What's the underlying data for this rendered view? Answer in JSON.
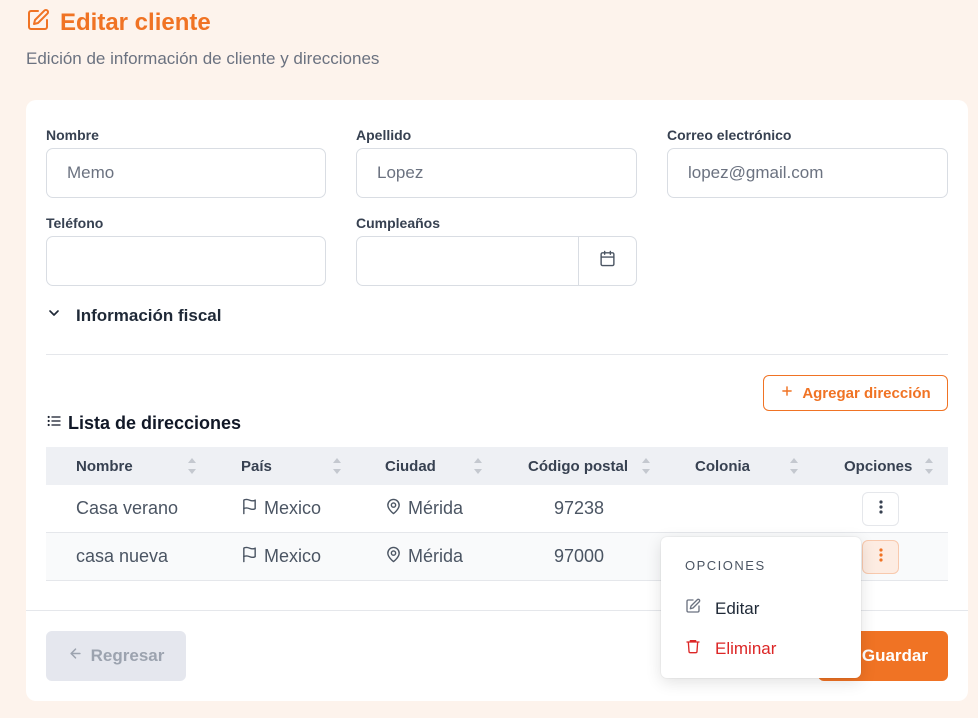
{
  "header": {
    "title": "Editar cliente",
    "subtitle": "Edición de información de cliente y direcciones"
  },
  "form": {
    "nombre_label": "Nombre",
    "nombre_value": "Memo",
    "apellido_label": "Apellido",
    "apellido_value": "Lopez",
    "correo_label": "Correo electrónico",
    "correo_value": "lopez@gmail.com",
    "telefono_label": "Teléfono",
    "telefono_value": "",
    "cumple_label": "Cumpleaños",
    "cumple_value": ""
  },
  "fiscal": {
    "label": "Información fiscal"
  },
  "addresses": {
    "add_label": "Agregar dirección",
    "list_title": "Lista de direcciones",
    "columns": [
      "Nombre",
      "País",
      "Ciudad",
      "Código postal",
      "Colonia",
      "Opciones"
    ],
    "rows": [
      {
        "nombre": "Casa verano",
        "pais": "Mexico",
        "ciudad": "Mérida",
        "cp": "97238",
        "colonia": ""
      },
      {
        "nombre": "casa nueva",
        "pais": "Mexico",
        "ciudad": "Mérida",
        "cp": "97000",
        "colonia": ""
      }
    ]
  },
  "menu": {
    "heading": "OPCIONES",
    "edit_label": "Editar",
    "delete_label": "Eliminar"
  },
  "footer": {
    "back_label": "Regresar",
    "save_label": "Guardar"
  },
  "colors": {
    "accent": "#f07324",
    "danger": "#dc2626"
  }
}
